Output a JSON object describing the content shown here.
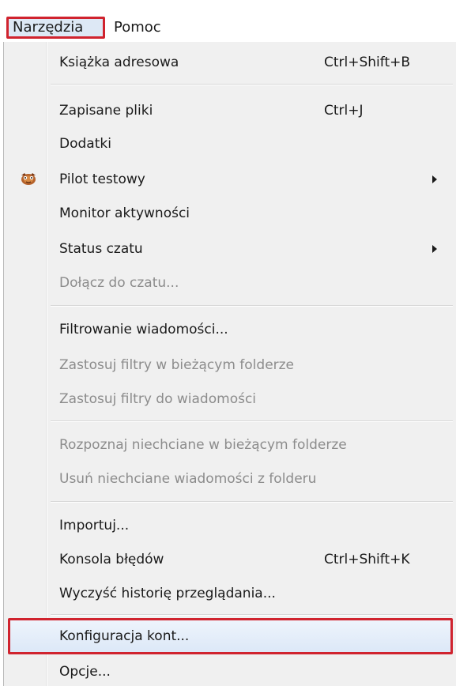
{
  "menubar": {
    "narzedzia": "Narzędzia",
    "pomoc": "Pomoc"
  },
  "menu": {
    "items": [
      {
        "label": "Książka adresowa",
        "shortcut": "Ctrl+Shift+B"
      },
      {
        "label": "Zapisane pliki",
        "shortcut": "Ctrl+J"
      },
      {
        "label": "Dodatki"
      },
      {
        "label": "Pilot testowy",
        "icon": "pilot-icon",
        "submenu": true
      },
      {
        "label": "Monitor aktywności"
      },
      {
        "label": "Status czatu",
        "submenu": true
      },
      {
        "label": "Dołącz do czatu...",
        "disabled": true
      },
      {
        "label": "Filtrowanie wiadomości..."
      },
      {
        "label": "Zastosuj filtry w bieżącym folderze",
        "disabled": true
      },
      {
        "label": "Zastosuj filtry do wiadomości",
        "disabled": true
      },
      {
        "label": "Rozpoznaj niechciane w bieżącym folderze",
        "disabled": true
      },
      {
        "label": "Usuń niechciane wiadomości z folderu",
        "disabled": true
      },
      {
        "label": "Importuj..."
      },
      {
        "label": "Konsola błędów",
        "shortcut": "Ctrl+Shift+K"
      },
      {
        "label": "Wyczyść historię przeglądania..."
      },
      {
        "label": "Konfiguracja kont...",
        "highlighted": true
      },
      {
        "label": "Opcje..."
      }
    ]
  },
  "colors": {
    "highlight_border": "#d0232e",
    "menu_background": "#f0f0f0",
    "disabled_text": "#8c8c8c"
  }
}
